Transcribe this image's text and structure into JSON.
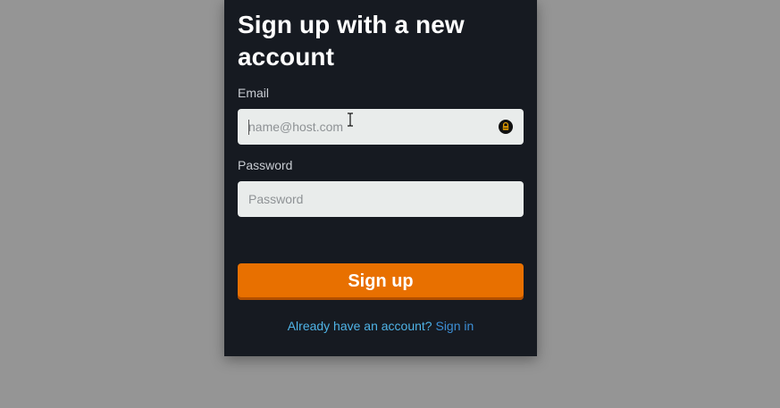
{
  "form": {
    "title": "Sign up with a new account",
    "email_label": "Email",
    "email_placeholder": "name@host.com",
    "email_value": "",
    "password_label": "Password",
    "password_placeholder": "Password",
    "password_value": "",
    "submit_label": "Sign up",
    "footer_question": "Already have an account?",
    "footer_link": "Sign in"
  },
  "icons": {
    "password_manager": "lock-icon",
    "cursor": "text-cursor-icon"
  },
  "colors": {
    "background": "#959595",
    "panel": "#161a21",
    "accent": "#e87000",
    "link": "#3d8fd6",
    "footer_text": "#4fb3e6"
  }
}
